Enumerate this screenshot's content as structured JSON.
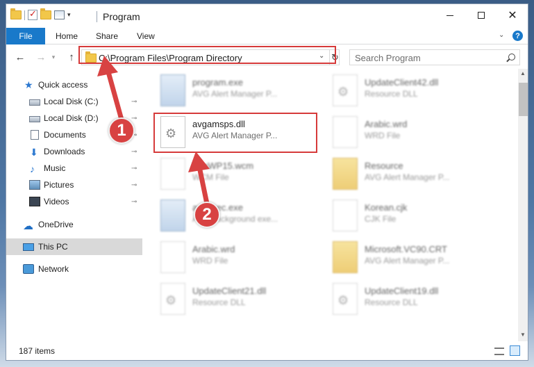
{
  "window": {
    "title": "Program",
    "minimize_label": "",
    "maximize_label": "",
    "close_label": "✕"
  },
  "ribbon": {
    "file_tab": "File",
    "home_tab": "Home",
    "share_tab": "Share",
    "view_tab": "View",
    "help_label": "?"
  },
  "navigation": {
    "back": "←",
    "forward": "→",
    "recent": "▾",
    "up": "↑",
    "address_path": "C:\\Program Files\\Program Directory",
    "address_dropdown": "⌄",
    "refresh": "↻"
  },
  "search": {
    "placeholder": "Search Program"
  },
  "sidebar": {
    "items": [
      {
        "label": "Quick access",
        "icon": "star-icon"
      },
      {
        "label": "Local Disk (C:)",
        "icon": "drive-icon",
        "pinned": true
      },
      {
        "label": "Local Disk (D:)",
        "icon": "drive-icon",
        "pinned": true
      },
      {
        "label": "Documents",
        "icon": "documents-icon",
        "pinned": true
      },
      {
        "label": "Downloads",
        "icon": "downloads-icon",
        "pinned": true
      },
      {
        "label": "Music",
        "icon": "music-icon",
        "pinned": true
      },
      {
        "label": "Pictures",
        "icon": "pictures-icon",
        "pinned": true
      },
      {
        "label": "Videos",
        "icon": "videos-icon",
        "pinned": true
      },
      {
        "label": "OneDrive",
        "icon": "onedrive-icon"
      },
      {
        "label": "This PC",
        "icon": "pc-icon",
        "selected": true
      },
      {
        "label": "Network",
        "icon": "network-icon"
      }
    ],
    "pin_glyph": "📌"
  },
  "files": [
    {
      "name": "program.exe",
      "sub": "AVG Alert Manager P...",
      "icon": "exe",
      "blurred": true
    },
    {
      "name": "UpdateClient42.dll",
      "sub": "Resource DLL",
      "icon": "dll",
      "blurred": true
    },
    {
      "name": "avgamsps.dll",
      "sub": "AVG Alert Manager P...",
      "icon": "dll",
      "blurred": false
    },
    {
      "name": "Arabic.wrd",
      "sub": "WRD File",
      "icon": "doc",
      "blurred": true
    },
    {
      "name": "WinWP15.wcm",
      "sub": "WCM File",
      "icon": "doc",
      "blurred": true
    },
    {
      "name": "Resource",
      "sub": "AVG Alert Manager P...",
      "icon": "folder",
      "blurred": true
    },
    {
      "name": "avgexec.exe",
      "sub": "AVG background exe...",
      "icon": "exe",
      "blurred": true
    },
    {
      "name": "Korean.cjk",
      "sub": "CJK File",
      "icon": "doc",
      "blurred": true
    },
    {
      "name": "Arabic.wrd",
      "sub": "WRD File",
      "icon": "doc",
      "blurred": true
    },
    {
      "name": "Microsoft.VC90.CRT",
      "sub": "AVG Alert Manager P...",
      "icon": "folder",
      "blurred": true
    },
    {
      "name": "UpdateClient21.dll",
      "sub": "Resource DLL",
      "icon": "dll",
      "blurred": true
    },
    {
      "name": "UpdateClient19.dll",
      "sub": "Resource DLL",
      "icon": "dll",
      "blurred": true
    }
  ],
  "status": {
    "item_count": "187 items"
  },
  "annotations": {
    "step1": "1",
    "step2": "2",
    "highlight_color": "#d63a3a"
  },
  "colors": {
    "accent": "#1979ca",
    "selected": "#d9d9d9"
  }
}
